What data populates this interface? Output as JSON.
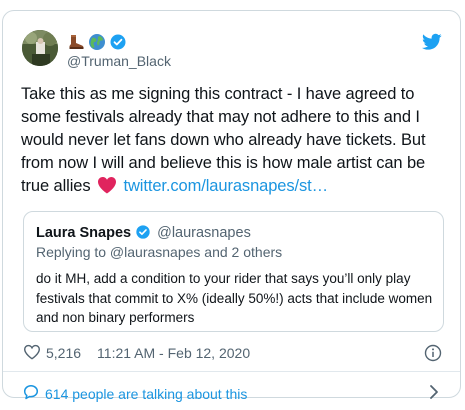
{
  "tweet": {
    "username": "@Truman_Black",
    "emoji_icons": [
      "boot-icon",
      "earth-globe-icon"
    ],
    "verified_icon": "verified-badge-icon",
    "text_before_heart": "Take this as me signing this contract - I have agreed to some festivals already that may not adhere to this and I would never let fans down who already have tickets. But from now I will and believe this is how male artist can be true allies",
    "link_text": "twitter.com/laurasnapes/st…",
    "likes": "5,216",
    "timestamp": "11:21 AM - Feb 12, 2020"
  },
  "quote": {
    "name": "Laura Snapes",
    "handle": "@laurasnapes",
    "reply_line": "Replying to @laurasnapes and 2 others",
    "text": "do it MH, add a condition to your rider that says you’ll only play festivals that commit to X% (ideally 50%!) acts that include women and non binary performers"
  },
  "footer": {
    "talking_label": "614 people are talking about this"
  },
  "colors": {
    "link": "#1b95e0",
    "twitter_blue": "#1da1f2",
    "heart_red": "#e0245e",
    "muted": "#536471"
  }
}
